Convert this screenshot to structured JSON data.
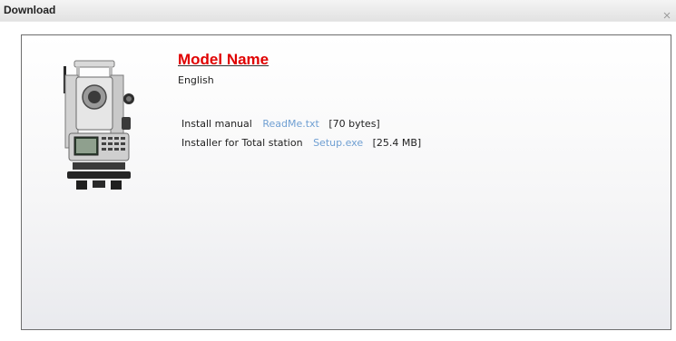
{
  "window": {
    "title": "Download"
  },
  "product": {
    "model_name": "Model Name",
    "language": "English",
    "image_icon": "total-station-image"
  },
  "files": [
    {
      "description": "Install manual",
      "link_text": "ReadMe.txt",
      "size": "[70 bytes]"
    },
    {
      "description": "Installer for Total station",
      "link_text": "Setup.exe",
      "size": "[25.4 MB]"
    }
  ],
  "colors": {
    "model_name": "#e00000",
    "link": "#6f9fd2",
    "panel_border": "#6e6e6e"
  }
}
